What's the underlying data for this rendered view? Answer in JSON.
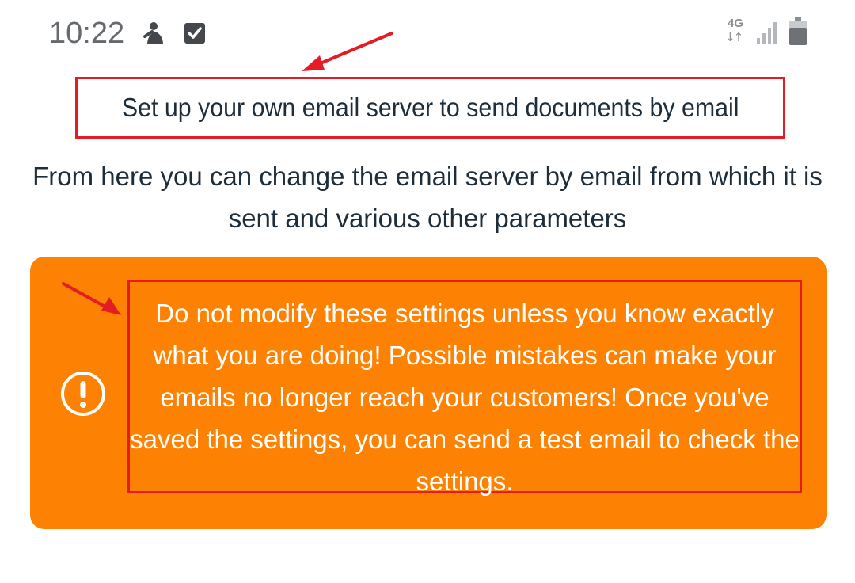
{
  "status_bar": {
    "time": "10:22",
    "network_type": "4G",
    "network_arrows": "↓↑",
    "icons": [
      "cleaner-app-icon",
      "checkbox-icon",
      "signal-icon",
      "battery-icon"
    ]
  },
  "heading": "Set up your own email server to send documents by email",
  "subtitle": "From here you can change the email server by email from which it is sent and various other parameters",
  "warning": {
    "icon": "exclamation-circle-icon",
    "text": "Do not modify these settings unless you know exactly what you are doing! Possible mistakes can make your emails no longer reach your customers! Once you've saved the settings, you can send a test email to check the settings."
  },
  "colors": {
    "warning_background": "#fd8204",
    "annotation_red": "#e41c25",
    "text_dark": "#1e2d3a",
    "status_gray": "#666a6e"
  }
}
